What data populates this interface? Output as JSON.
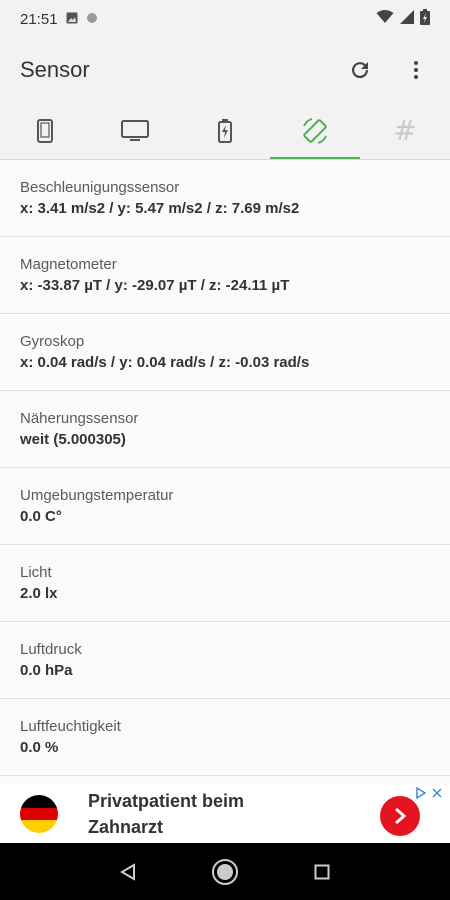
{
  "status": {
    "time": "21:51"
  },
  "app": {
    "title": "Sensor"
  },
  "tabs": [
    {
      "icon": "phone-icon",
      "active": false
    },
    {
      "icon": "monitor-icon",
      "active": false
    },
    {
      "icon": "battery-icon",
      "active": false
    },
    {
      "icon": "screen-rotation-icon",
      "active": true
    },
    {
      "icon": "hash-icon",
      "active": false
    }
  ],
  "sensors": [
    {
      "label": "Beschleunigungssensor",
      "value": "x: 3.41 m/s2 / y: 5.47 m/s2 / z: 7.69 m/s2"
    },
    {
      "label": "Magnetometer",
      "value": "x: -33.87 µT / y: -29.07 µT / z: -24.11 µT"
    },
    {
      "label": "Gyroskop",
      "value": "x: 0.04 rad/s / y: 0.04 rad/s / z: -0.03 rad/s"
    },
    {
      "label": "Näherungssensor",
      "value": "weit (5.000305)"
    },
    {
      "label": "Umgebungstemperatur",
      "value": "0.0 C°"
    },
    {
      "label": "Licht",
      "value": "2.0 lx"
    },
    {
      "label": "Luftdruck",
      "value": "0.0 hPa"
    },
    {
      "label": "Luftfeuchtigkeit",
      "value": "0.0 %"
    }
  ],
  "ad": {
    "text": "Privatpatient beim Zahnarzt"
  },
  "colors": {
    "accent": "#4caf50",
    "ad_button": "#e4151f"
  }
}
